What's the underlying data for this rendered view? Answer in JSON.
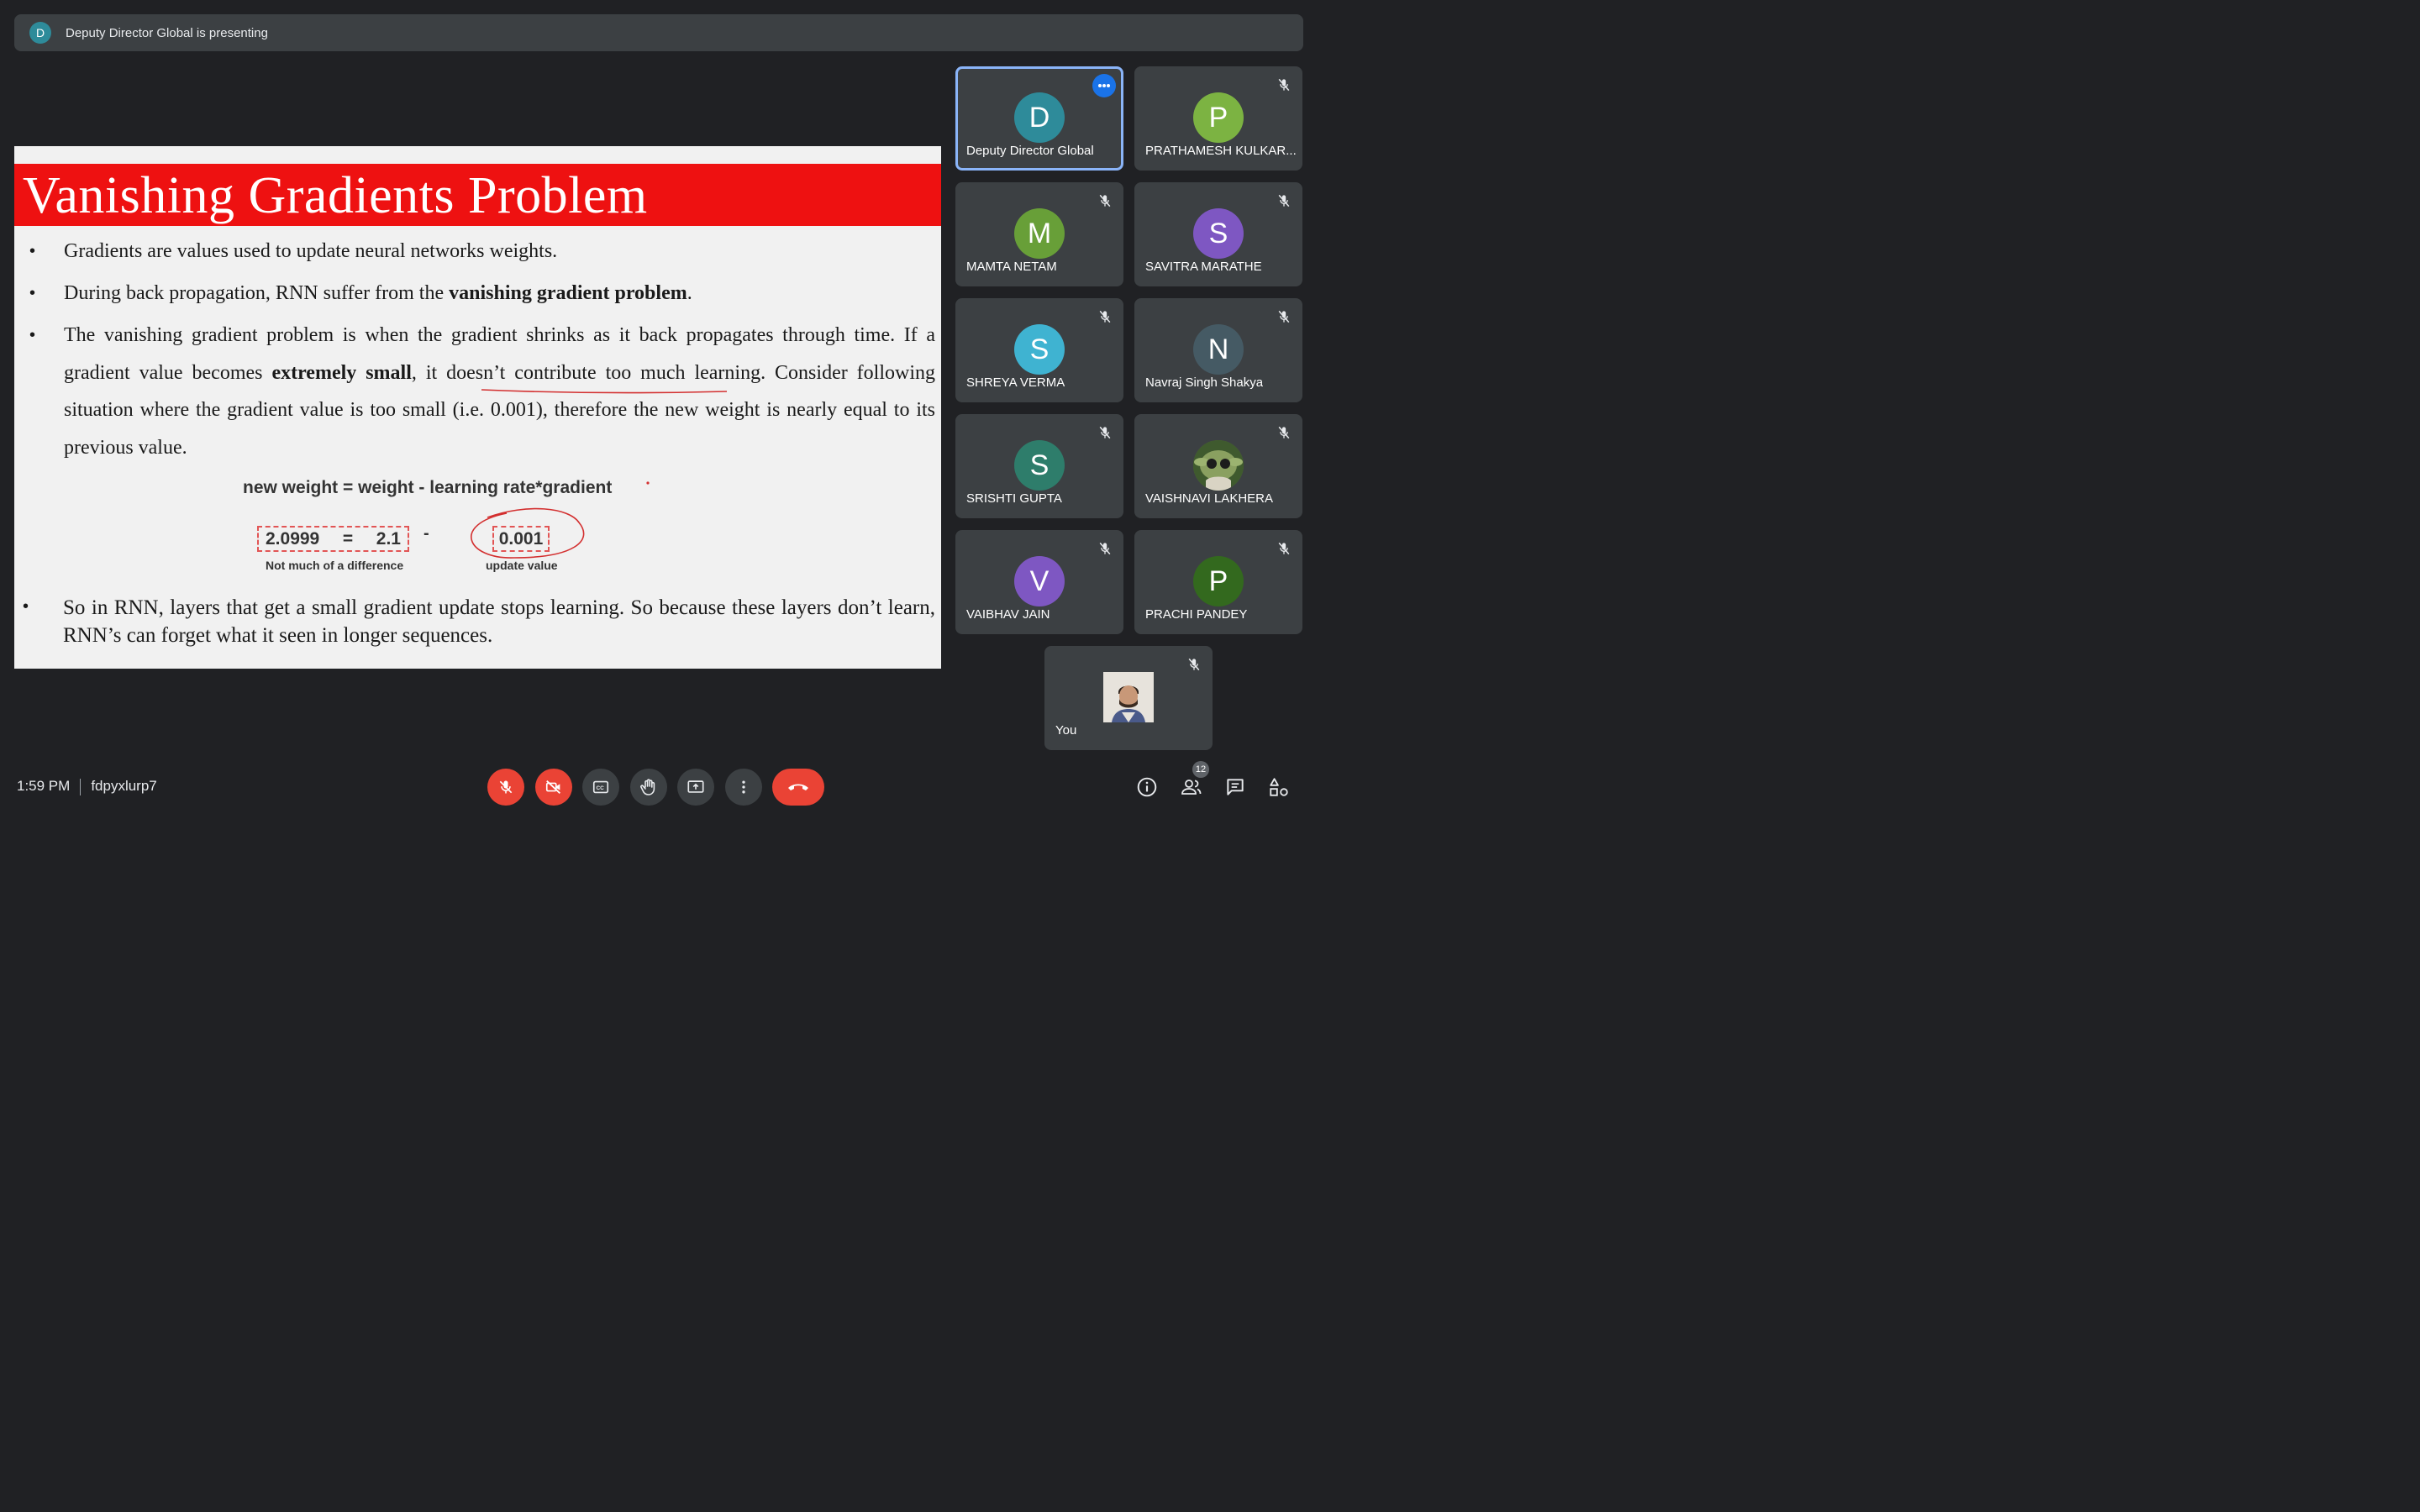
{
  "banner": {
    "avatar_letter": "D",
    "text": "Deputy Director Global is presenting"
  },
  "slide": {
    "title": "Vanishing Gradients Problem",
    "bullets": [
      {
        "text": "Gradients are values used to update neural networks weights."
      },
      {
        "pre": "During back propagation, RNN suffer from the ",
        "bold": "vanishing gradient problem",
        "post": "."
      },
      {
        "pre": "The vanishing gradient problem is when the gradient shrinks as it back propagates through time. If a gradient value becomes ",
        "bold": "extremely small",
        "post": ", it doesn’t contribute too much learning. Consider following situation where the gradient value is too small (i.e. 0.001), therefore the new weight is nearly equal to its previous value."
      },
      {
        "text": "So in RNN, layers that get a small gradient update stops learning. So because these layers don’t learn, RNN’s can forget what it seen in longer sequences."
      }
    ],
    "bullet_symbol": "•",
    "formula": "new weight = weight - learning rate*gradient",
    "box1_left": "2.0999",
    "box1_eq": "=",
    "box1_right": "2.1",
    "minus": "-",
    "box2_value": "0.001",
    "caption1": "Not much of a difference",
    "caption2": "update value"
  },
  "participants": [
    {
      "name": "Deputy Director Global",
      "letter": "D",
      "color": "#2e8b9a",
      "active": true,
      "icon": "more-options-icon"
    },
    {
      "name": "PRATHAMESH KULKAR...",
      "letter": "P",
      "color": "#7cb342",
      "icon": "mic-off-icon"
    },
    {
      "name": "MAMTA NETAM",
      "letter": "M",
      "color": "#689f38",
      "icon": "mic-off-icon"
    },
    {
      "name": "SAVITRA MARATHE",
      "letter": "S",
      "color": "#7e57c2",
      "icon": "mic-off-icon"
    },
    {
      "name": "SHREYA VERMA",
      "letter": "S",
      "color": "#3fb3d1",
      "icon": "mic-off-icon"
    },
    {
      "name": "Navraj Singh Shakya",
      "letter": "N",
      "color": "#455a64",
      "icon": "mic-off-icon"
    },
    {
      "name": "SRISHTI GUPTA",
      "letter": "S",
      "color": "#2e7d6b",
      "icon": "mic-off-icon"
    },
    {
      "name": "VAISHNAVI LAKHERA",
      "letter": "",
      "color": "#5a6b3d",
      "icon": "mic-off-icon"
    },
    {
      "name": "VAIBHAV JAIN",
      "letter": "V",
      "color": "#7e57c2",
      "icon": "mic-off-icon"
    },
    {
      "name": "PRACHI PANDEY",
      "letter": "P",
      "color": "#33691e",
      "icon": "mic-off-icon"
    },
    {
      "name": "You",
      "letter": "",
      "color": "#d8d2c8",
      "icon": "mic-off-icon"
    }
  ],
  "footer": {
    "time": "1:59 PM",
    "meeting_code": "fdpyxlurp7",
    "people_count": "12"
  },
  "colors": {
    "background": "#202124",
    "tile": "#3c4043",
    "danger": "#ea4335",
    "active_border": "#8ab4f8",
    "slide_title_bar": "#ee1111"
  }
}
